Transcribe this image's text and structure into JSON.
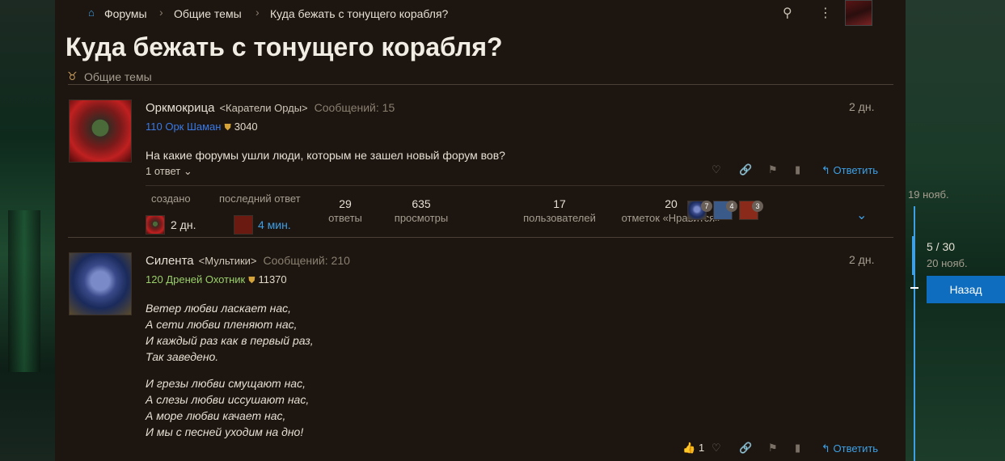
{
  "breadcrumb": {
    "forums": "Форумы",
    "general": "Общие темы",
    "topic": "Куда бежать с тонущего корабля?"
  },
  "page_title": "Куда бежать с тонущего корабля?",
  "category": "Общие темы",
  "post1": {
    "author": "Оркмокрица",
    "guild": "<Каратели Орды>",
    "post_count": "Сообщений: 15",
    "class_line": "110 Орк Шаман",
    "achievement": "3040",
    "date": "2 дн.",
    "text": "На какие форумы ушли люди, которым не зашел новый форум вов?",
    "replies": "1 ответ ⌄",
    "reply_label": "Ответить"
  },
  "summary": {
    "created_label": "создано",
    "created_val": "2 дн.",
    "last_label": "последний ответ",
    "last_val": "4 мин.",
    "stats": [
      {
        "num": "29",
        "cap": "ответы"
      },
      {
        "num": "635",
        "cap": "просмотры"
      },
      {
        "num": "17",
        "cap": "пользователей"
      },
      {
        "num": "20",
        "cap": "отметок «Нравится»"
      }
    ],
    "badges": [
      "7",
      "4",
      "3"
    ]
  },
  "post2": {
    "author": "Силента",
    "guild": "<Мультики>",
    "post_count": "Сообщений: 210",
    "class_line": "120 Дреней Охотник",
    "achievement": "11370",
    "date": "2 дн.",
    "poem1": [
      "Ветер любви ласкает нас,",
      "А сети любви пленяют нас,",
      "И каждый раз как в первый раз,",
      "Так заведено."
    ],
    "poem2": [
      "И грезы любви смущают нас,",
      "А слезы любви иссушают нас,",
      "А море любви качает нас,",
      "И мы с песней уходим на дно!"
    ],
    "likes": "1",
    "reply_label": "Ответить"
  },
  "timeline": {
    "date_top": "19 нояб.",
    "position": "5 / 30",
    "date_current": "20 нояб.",
    "back": "Назад"
  },
  "colors": {
    "accent": "#3da0e6",
    "background": "#1c1510",
    "shaman": "#3a7ae6",
    "hunter": "#9ad06a"
  }
}
